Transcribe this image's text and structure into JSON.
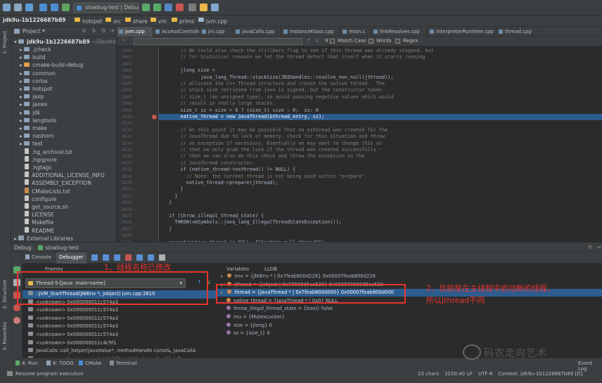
{
  "toolbar": {
    "run_config": "slowbug-test | Debug"
  },
  "breadcrumb": [
    "jdk9u-1b1226687b89",
    "hotspot",
    "src",
    "share",
    "vm",
    "prims",
    "jvm.cpp"
  ],
  "project_panel": {
    "title": "Project",
    "root": "jdk9u-1b1226687b89",
    "root_path": "~/Desktop/j",
    "items": [
      {
        "name": ".jcheck",
        "kind": "folder"
      },
      {
        "name": "build",
        "kind": "folder"
      },
      {
        "name": "cmake-build-debug",
        "kind": "folder-open"
      },
      {
        "name": "common",
        "kind": "folder"
      },
      {
        "name": "corba",
        "kind": "folder"
      },
      {
        "name": "hotspot",
        "kind": "folder"
      },
      {
        "name": "jaxp",
        "kind": "folder"
      },
      {
        "name": "jaxws",
        "kind": "folder"
      },
      {
        "name": "jdk",
        "kind": "folder"
      },
      {
        "name": "langtools",
        "kind": "folder"
      },
      {
        "name": "make",
        "kind": "folder"
      },
      {
        "name": "nashorn",
        "kind": "folder"
      },
      {
        "name": "test",
        "kind": "folder"
      },
      {
        "name": ".hg_archival.txt",
        "kind": "file"
      },
      {
        "name": ".hgignore",
        "kind": "file"
      },
      {
        "name": ".hgtags",
        "kind": "file"
      },
      {
        "name": "ADDITIONAL_LICENSE_INFO",
        "kind": "file"
      },
      {
        "name": "ASSEMBLY_EXCEPTION",
        "kind": "file"
      },
      {
        "name": "CMakeLists.txt",
        "kind": "cmake"
      },
      {
        "name": "configure",
        "kind": "file"
      },
      {
        "name": "get_source.sh",
        "kind": "file"
      },
      {
        "name": "LICENSE",
        "kind": "file"
      },
      {
        "name": "Makefile",
        "kind": "file"
      },
      {
        "name": "README",
        "kind": "file"
      },
      {
        "name": "External Libraries",
        "kind": "lib"
      }
    ]
  },
  "editor_tabs": [
    "jvm.cpp",
    "AccessController.c",
    "jni.cpp",
    "javaCalls.cpp",
    "instanceKlass.cpp",
    "main.c",
    "linkResolver.cpp",
    "interpreterRuntime.cpp",
    "thread.cpp"
  ],
  "find_bar": {
    "match_case": "Match Case",
    "words": "Words",
    "regex": "Regex"
  },
  "code_lines": [
    {
      "n": "2800",
      "t": "      // We could also check the stillborn flag to see if this thread was already stopped, but",
      "c": "#808080"
    },
    {
      "n": "2801",
      "t": "      // for historical reasons we let the thread detect that itself when it starts running",
      "c": "#808080"
    },
    {
      "n": "2802",
      "t": "",
      "c": "#a9b7c6"
    },
    {
      "n": "2803",
      "t": "      jlong size =",
      "c": "#a9b7c6"
    },
    {
      "n": "2804",
      "t": "             java_lang_Thread::stackSize(JNIHandles::resolve_non_null(jthread));",
      "c": "#a9b7c6"
    },
    {
      "n": "2805",
      "t": "      // Allocate the C++ Thread structure and create the native thread.  The",
      "c": "#808080"
    },
    {
      "n": "2806",
      "t": "      // stack size retrieved from java is signed, but the constructor takes",
      "c": "#808080"
    },
    {
      "n": "2807",
      "t": "      // size_t (an unsigned type), so avoid passing negative values which would",
      "c": "#808080"
    },
    {
      "n": "2808",
      "t": "      // result in really large stacks.",
      "c": "#808080"
    },
    {
      "n": "2809",
      "t": "      size_t sz = size > 0 ? (size_t) size : 0;  sz: 0",
      "c": "#a9b7c6"
    },
    {
      "n": "2810",
      "t": "      native_thread = new JavaThread(&thread_entry, sz);",
      "c": "#ffffff"
    },
    {
      "n": "2811",
      "t": "",
      "c": "#a9b7c6"
    },
    {
      "n": "2812",
      "t": "      // At this point it may be possible that no osthread was created for the",
      "c": "#808080"
    },
    {
      "n": "2813",
      "t": "      // JavaThread due to lack of memory. Check for this situation and throw",
      "c": "#808080"
    },
    {
      "n": "2814",
      "t": "      // an exception if necessary. Eventually we may want to change this so",
      "c": "#808080"
    },
    {
      "n": "2815",
      "t": "      // that we only grab the lock if the thread was created successfully -",
      "c": "#808080"
    },
    {
      "n": "2816",
      "t": "      // then we can also do this check and throw the exception in the",
      "c": "#808080"
    },
    {
      "n": "2817",
      "t": "      // JavaThread constructor.",
      "c": "#808080"
    },
    {
      "n": "2818",
      "t": "      if (native_thread->osthread() != NULL) {",
      "c": "#a9b7c6"
    },
    {
      "n": "2819",
      "t": "        // Note: the current thread is not being used within \"prepare\".",
      "c": "#808080"
    },
    {
      "n": "2820",
      "t": "        native_thread->prepare(jthread);",
      "c": "#a9b7c6"
    },
    {
      "n": "2821",
      "t": "      }",
      "c": "#a9b7c6"
    },
    {
      "n": "2822",
      "t": "    }",
      "c": "#a9b7c6"
    },
    {
      "n": "2823",
      "t": "  }",
      "c": "#a9b7c6"
    },
    {
      "n": "2824",
      "t": "",
      "c": "#a9b7c6"
    },
    {
      "n": "2825",
      "t": "  if (throw_illegal_thread_state) {",
      "c": "#a9b7c6"
    },
    {
      "n": "2826",
      "t": "    THROW(vmSymbols::java_lang_IllegalThreadStateException());",
      "c": "#a9b7c6"
    },
    {
      "n": "2827",
      "t": "  }",
      "c": "#a9b7c6"
    },
    {
      "n": "2828",
      "t": "",
      "c": "#a9b7c6"
    },
    {
      "n": "2829",
      "t": "  assert(native_thread != NULL, \"Starting null thread?\");",
      "c": "#a9b7c6"
    }
  ],
  "debug": {
    "title": "Debug:",
    "config": "slowbug-test",
    "tabs": [
      "Console",
      "Debugger"
    ],
    "frames_label": "Frames",
    "variables_label": "Variables",
    "lldb_label": "LLDB",
    "thread_selector": "Thread-5-[Java: main-name]",
    "frames": [
      {
        "text": "::JVM_StartThread(JNIEnv *, jobject) jvm.cpp:2810",
        "selected": true
      },
      {
        "text": "<unknown> 0x000000011c574a3",
        "selected": false
      },
      {
        "text": "<unknown> 0x000000011c574a3",
        "selected": false
      },
      {
        "text": "<unknown> 0x000000011c574a3",
        "selected": false
      },
      {
        "text": "<unknown> 0x000000011c574a3",
        "selected": false
      },
      {
        "text": "<unknown> 0x000000011c574a3",
        "selected": false
      },
      {
        "text": "<unknown> 0x000000011c4c9f1",
        "selected": false
      },
      {
        "text": "JavaCalls::call_helper(JavaValue*, methodHandle const&, JavaCallA",
        "selected": false
      },
      {
        "text": "os::os_exception_wrapper(void (*)(JavaValue*, methodHandle cons",
        "selected": false
      }
    ],
    "variables": [
      {
        "text": "env = {JNIEnv * | 0x7feab800d228} 0x00007feab800d228",
        "icon": "#d08a4a",
        "selected": false
      },
      {
        "text": "jthread = {jobject | 0x70000d6ea528} 0x000070000d6ea528",
        "icon": "#d08a4a",
        "selected": false
      },
      {
        "text": "thread = {JavaThread * | 0x7feab800d000} 0x00007feab800d000",
        "icon": "#d08a4a",
        "selected": true
      },
      {
        "text": "native_thread = {JavaThread * | 0x0} NULL",
        "icon": "#d08a4a",
        "selected": false
      },
      {
        "text": "throw_illegal_thread_state = {bool} false",
        "icon": "#9876aa",
        "selected": false
      },
      {
        "text": "mu = {MutexLocker}",
        "icon": "#9876aa",
        "selected": false
      },
      {
        "text": "size = {jlong} 0",
        "icon": "#9876aa",
        "selected": false
      },
      {
        "text": "sz = {size_t} 0",
        "icon": "#9876aa",
        "selected": false
      }
    ]
  },
  "bottom_tabs": [
    "4: Run",
    "6: TODO",
    "CMake",
    "Terminal"
  ],
  "status": {
    "message": "Resume program execution",
    "chars": "23 chars",
    "position": "3150:40",
    "line_sep": "LF",
    "encoding": "UTF-8",
    "context": "Context: jdk9u-1b1226687b89 [D]",
    "event_log": "Event Log"
  },
  "annotations": {
    "a1": "1、线程名称已修改",
    "a2_line1": "2、目前是在主线程中启动新的线程，",
    "a2_line2": "所以jthread不同"
  },
  "watermark": "码农走向艺术",
  "side_labels": {
    "project": "1: Project",
    "structure": "2: Structure",
    "favorites": "2: Favorites"
  },
  "colors": {
    "selection": "#2d5c8e",
    "annotation": "#e8332e",
    "breakpoint": "#c75450"
  }
}
